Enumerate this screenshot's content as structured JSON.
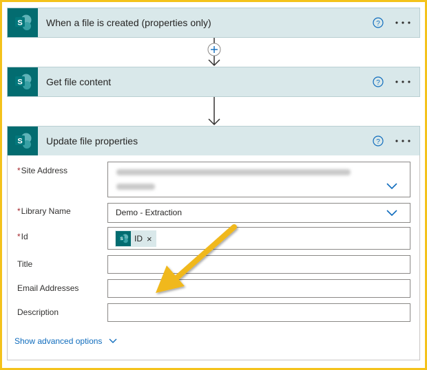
{
  "steps": [
    {
      "title": "When a file is created (properties only)",
      "logo_letter": "S"
    },
    {
      "title": "Get file content",
      "logo_letter": "S"
    },
    {
      "title": "Update file properties",
      "logo_letter": "S"
    }
  ],
  "insert_step_icon": "plus-icon",
  "form": {
    "site_address": {
      "label": "Site Address",
      "required": true,
      "value_blurred": true
    },
    "library_name": {
      "label": "Library Name",
      "required": true,
      "value": "Demo - Extraction"
    },
    "id": {
      "label": "Id",
      "required": true,
      "token": "ID",
      "token_close": "×"
    },
    "title": {
      "label": "Title",
      "required": false,
      "value": ""
    },
    "email_addresses": {
      "label": "Email Addresses",
      "required": false,
      "value": ""
    },
    "description": {
      "label": "Description",
      "required": false,
      "value": ""
    }
  },
  "required_marker": "*",
  "show_advanced": "Show advanced options",
  "colors": {
    "frame": "#f4c21b",
    "header_bg": "#d9e8ea",
    "sharepoint_teal": "#036c70",
    "link": "#0f6cbd",
    "required": "#a4262c",
    "arrow": "#f0b81d"
  },
  "annotation": {
    "type": "arrow",
    "color": "#f0b81d",
    "points_to": "email-addresses-field"
  }
}
